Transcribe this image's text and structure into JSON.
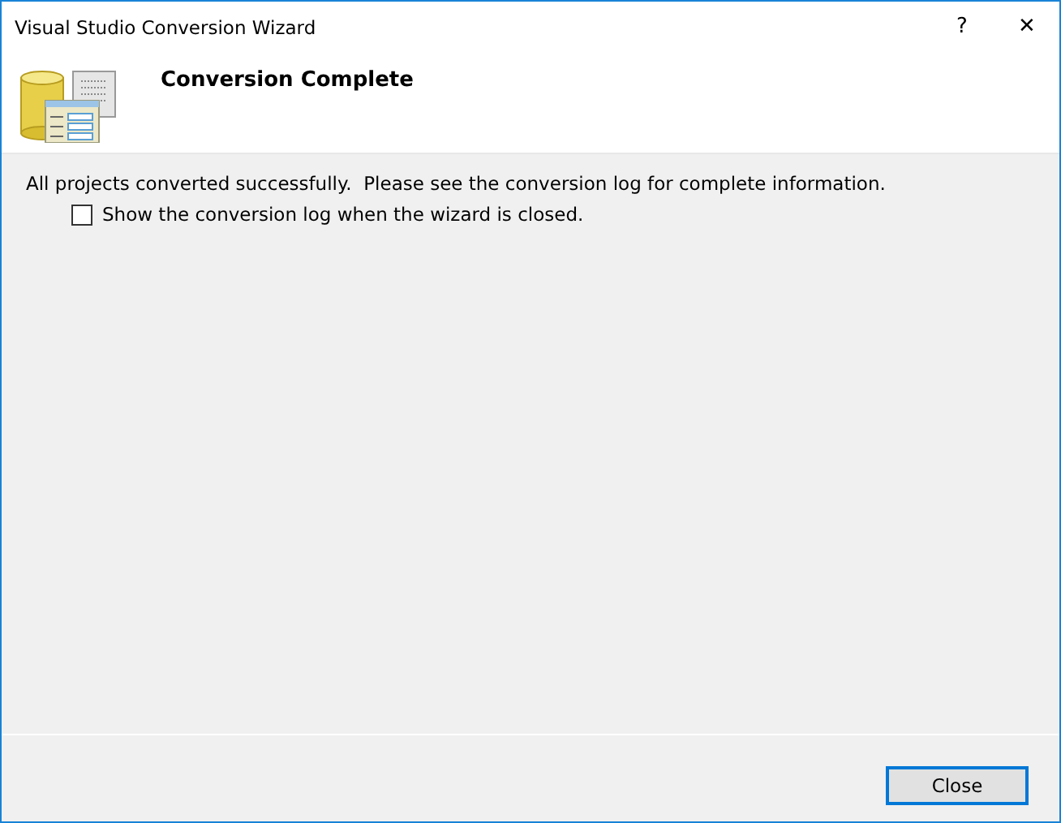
{
  "window": {
    "title": "Visual Studio Conversion Wizard",
    "help_button": "?",
    "close_button": "✕"
  },
  "header": {
    "title": "Conversion Complete"
  },
  "message": "All projects converted successfully.  Please see the conversion log for complete information.",
  "show_log_option": {
    "label": "Show the conversion log when the wizard is closed.",
    "checked": false
  },
  "buttons": [
    {
      "label": "Close",
      "focused": true
    }
  ]
}
